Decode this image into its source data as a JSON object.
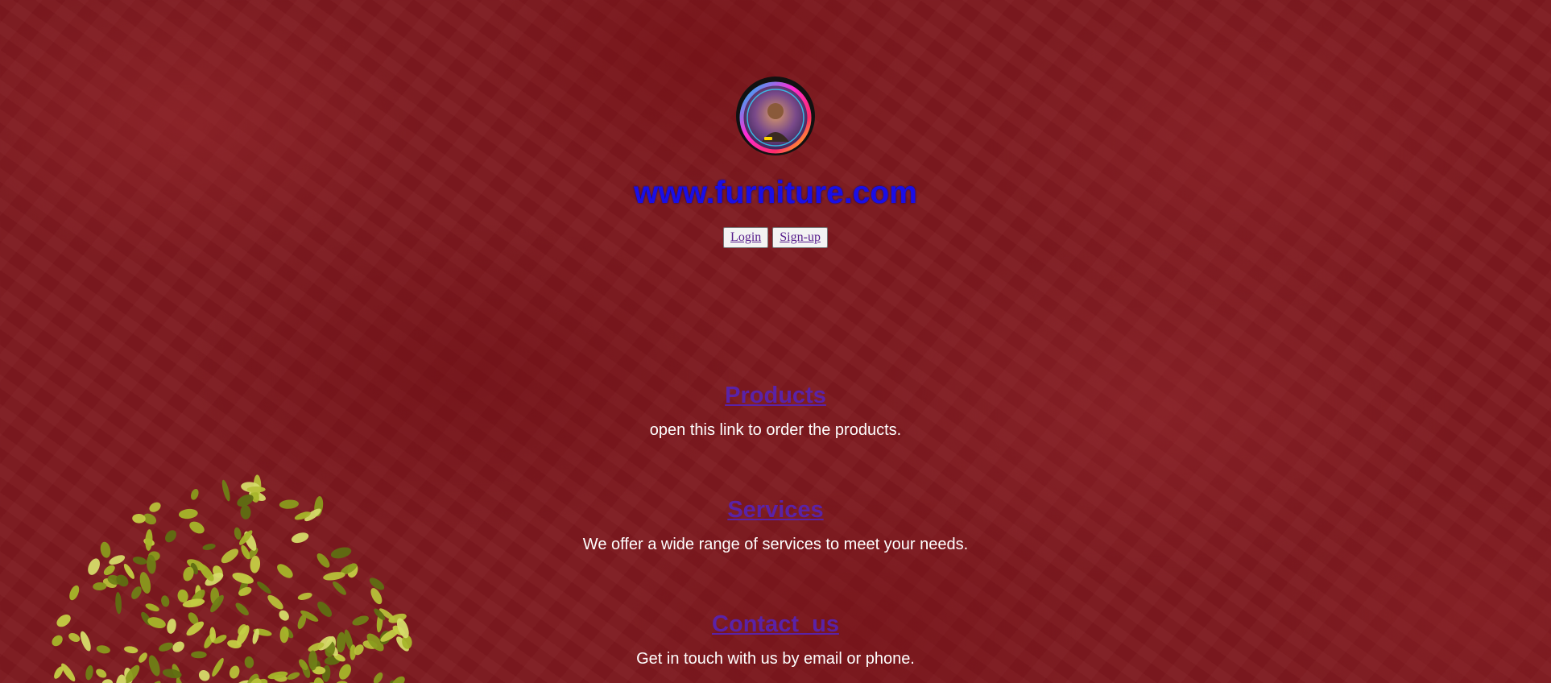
{
  "header": {
    "avatar_icon": "profile-avatar-neon-ring",
    "site_title": "www.furniture.com",
    "login_label": "Login",
    "signup_label": "Sign-up"
  },
  "sections": [
    {
      "link": "Products",
      "description": "open this link to order the products."
    },
    {
      "link": "Services",
      "description": "We offer a wide range of services to meet your needs."
    },
    {
      "link": "Contact_us",
      "description": "Get in touch with us by email or phone."
    }
  ],
  "colors": {
    "background": "#7e1a20",
    "title": "#1a0ee6",
    "link": "#5a22a8",
    "description": "#ffffff"
  },
  "decor": {
    "plant_icon": "potted-plant-leaves"
  }
}
